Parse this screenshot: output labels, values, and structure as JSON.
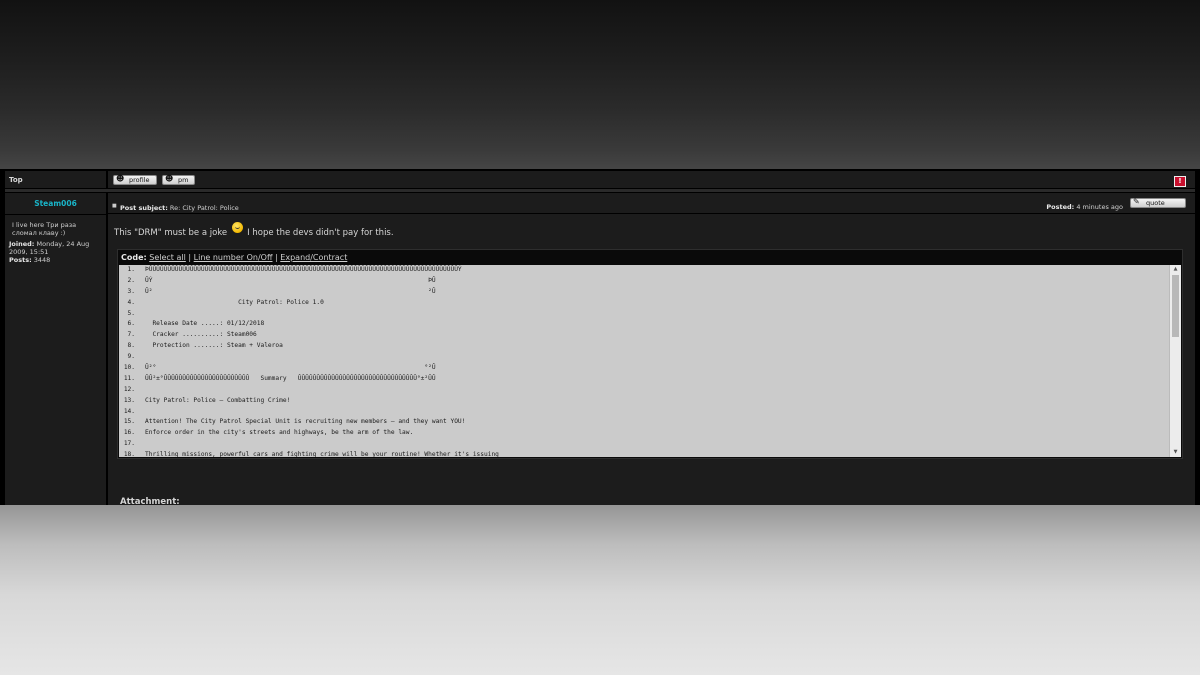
{
  "top_row": {
    "top_link": "Top",
    "profile_label": "profile",
    "pm_label": "pm",
    "report_icon": "warning-icon"
  },
  "author": {
    "name": "Steam006",
    "title": "I live here Три раза сломал клаву :)",
    "joined_label": "Joined:",
    "joined_value": "Monday, 24 Aug 2009, 15:51",
    "posts_label": "Posts:",
    "posts_value": "3448"
  },
  "post": {
    "subject_label": "Post subject:",
    "subject": "Re: City Patrol: Police",
    "posted_label": "Posted:",
    "posted_value": "4 minutes ago",
    "quote_label": "quote",
    "message_before": "This \"DRM\" must be a joke",
    "message_after": "I hope the devs didn't pay for this.",
    "attachment_label": "Attachment:"
  },
  "code_block": {
    "label": "Code:",
    "select_all": "Select all",
    "separator": "|",
    "line_number_toggle": "Line number On/Off",
    "expand_contract": "Expand/Contract",
    "lines": [
      {
        "n": "1.",
        "text": "ÞÛÛÛÛÛÛÛÛÛÛÛÛÛÛÛÛÛÛÛÛÛÛÛÛÛÛÛÛÛÛÛÛÛÛÛÛÛÛÛÛÛÛÛÛÛÛÛÛÛÛÛÛÛÛÛÛÛÛÛÛÛÛÛÛÛÛÛÛÛÛÛÛÛÛÛÛÛÛÛÛÛÛÛÝ"
      },
      {
        "n": "2.",
        "text": "ÛÝ                                                                          ÞÛ"
      },
      {
        "n": "3.",
        "text": "Û²                                                                          ²Û"
      },
      {
        "n": "4.",
        "text": "                         City Patrol: Police 1.0"
      },
      {
        "n": "5.",
        "text": ""
      },
      {
        "n": "6.",
        "text": "  Release Date .....: 01/12/2018"
      },
      {
        "n": "7.",
        "text": "  Cracker ..........: Steam006"
      },
      {
        "n": "8.",
        "text": "  Protection .......: Steam + Valeroa"
      },
      {
        "n": "9.",
        "text": ""
      },
      {
        "n": "10.",
        "text": "Û²°                                                                        °²Û"
      },
      {
        "n": "11.",
        "text": "ÛÛ²±°ÛÛÛÛÛÛÛÛÛÛÛÛÛÛÛÛÛÛÛÛÛÛÛ   Summary   ÛÛÛÛÛÛÛÛÛÛÛÛÛÛÛÛÛÛÛÛÛÛÛÛÛÛÛÛÛÛÛÛ°±²ÛÛ"
      },
      {
        "n": "12.",
        "text": ""
      },
      {
        "n": "13.",
        "text": "City Patrol: Police – Combatting Crime!"
      },
      {
        "n": "14.",
        "text": ""
      },
      {
        "n": "15.",
        "text": "Attention! The City Patrol Special Unit is recruiting new members – and they want YOU!"
      },
      {
        "n": "16.",
        "text": "Enforce order in the city's streets and highways, be the arm of the law."
      },
      {
        "n": "17.",
        "text": ""
      },
      {
        "n": "18.",
        "text": "Thrilling missions, powerful cars and fighting crime will be your routine! Whether it's issuing"
      }
    ]
  }
}
